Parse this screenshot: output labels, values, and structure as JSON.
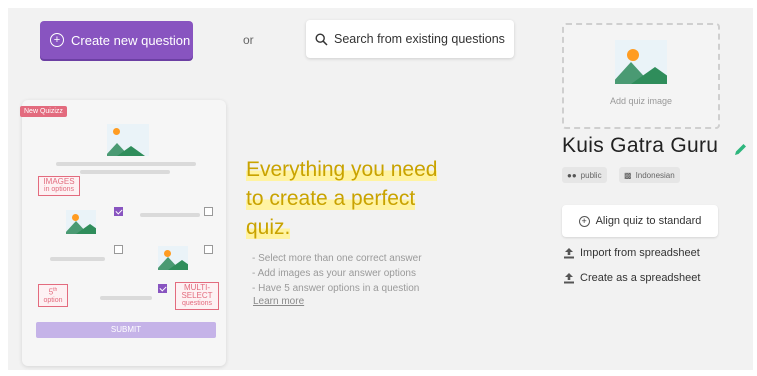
{
  "top": {
    "create_label": "Create new question",
    "or_label": "or",
    "search_label": "Search from existing questions"
  },
  "illustration": {
    "badge": "New Quizizz",
    "images_callout": "IMAGES",
    "images_callout_sub": "in options",
    "options_callout": "5",
    "options_callout_sup": "th",
    "options_callout_sub": "option",
    "multi_callout": "MULTI-SELECT",
    "multi_callout_sub": "questions",
    "submit_label": "SUBMIT"
  },
  "headline": {
    "line1": "Everything you need",
    "line2": "to create a perfect",
    "line3": "quiz.",
    "features": [
      "Select more than one correct answer",
      "Add images as your answer options",
      "Have 5 answer options in a question"
    ],
    "learn_more": "Learn more"
  },
  "quiz": {
    "add_image_label": "Add quiz image",
    "title": "Kuis Gatra Guru",
    "visibility": "public",
    "language": "Indonesian",
    "align_label": "Align quiz to standard",
    "import_label": "Import from spreadsheet",
    "create_sheet_label": "Create as a spreadsheet"
  },
  "colors": {
    "accent": "#8854c0",
    "headline": "#c9a300",
    "highlight": "#fff3a1",
    "callout": "#e36b7e",
    "edit_icon": "#2eb67d"
  }
}
